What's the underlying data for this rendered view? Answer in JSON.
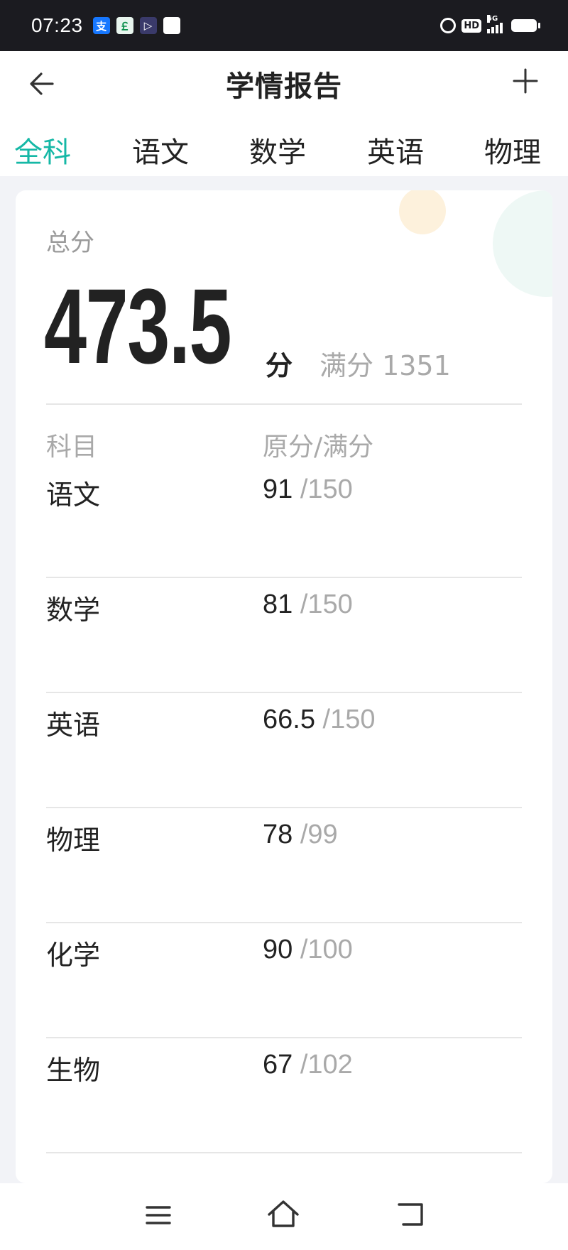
{
  "status_bar": {
    "time": "07:23",
    "apps": [
      {
        "icon": "alipay-icon",
        "glyph": "支",
        "color": "#1677ff"
      },
      {
        "icon": "green-app-icon",
        "glyph": "￡",
        "color": "#0a8f4c"
      },
      {
        "icon": "play-app-icon",
        "glyph": "▷",
        "color": "#3a3a6a"
      },
      {
        "icon": "white-square-icon",
        "glyph": "",
        "color": "#ffffff"
      }
    ],
    "hd": "HD",
    "network": "5G"
  },
  "header": {
    "title": "学情报告",
    "back_icon": "arrow-left-icon",
    "add_icon": "plus-icon"
  },
  "tabs": [
    {
      "label": "全科",
      "active": true
    },
    {
      "label": "语文",
      "active": false
    },
    {
      "label": "数学",
      "active": false
    },
    {
      "label": "英语",
      "active": false
    },
    {
      "label": "物理",
      "active": false
    }
  ],
  "summary": {
    "total_label": "总分",
    "total_score": "473.5",
    "unit": "分",
    "full_score": "满分 1351"
  },
  "table": {
    "headers": {
      "subject": "科目",
      "score": "原分/满分"
    },
    "rows": [
      {
        "subject": "语文",
        "score": "91",
        "full": "/150"
      },
      {
        "subject": "数学",
        "score": "81",
        "full": "/150"
      },
      {
        "subject": "英语",
        "score": "66.5",
        "full": "/150"
      },
      {
        "subject": "物理",
        "score": "78",
        "full": "/99"
      },
      {
        "subject": "化学",
        "score": "90",
        "full": "/100"
      },
      {
        "subject": "生物",
        "score": "67",
        "full": "/102"
      }
    ]
  },
  "colors": {
    "accent": "#15b8a6",
    "text": "#222222",
    "muted": "#a9a9a9"
  },
  "nav_bar": {
    "icons": [
      "menu-icon",
      "home-icon",
      "back-icon"
    ]
  }
}
